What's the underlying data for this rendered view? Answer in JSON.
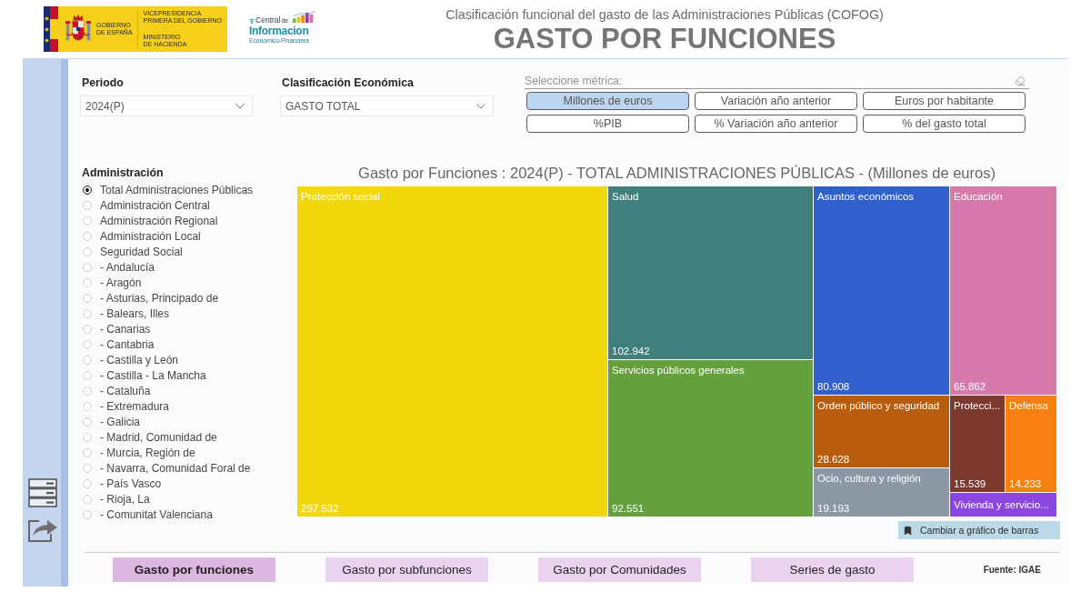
{
  "header": {
    "government_logo": {
      "emblem_lines": [
        "GOBIERNO",
        "DE ESPAÑA"
      ],
      "ministry_blocks": [
        [
          "VICEPRESIDENCIA",
          "PRIMERA DEL GOBIERNO"
        ],
        [
          "MINISTERIO",
          "DE HACIENDA"
        ]
      ]
    },
    "information_logo": {
      "top": "Central",
      "top_small": "de",
      "main": "Informacion",
      "bottom": "Económico-Financiera"
    },
    "subtitle": "Clasificación funcional del gasto de las Administraciones Públicas (COFOG)",
    "title": "GASTO POR FUNCIONES"
  },
  "filters": [
    {
      "label": "Periodo",
      "value": "2024(P)"
    },
    {
      "label": "Clasificación Económica",
      "value": "GASTO TOTAL"
    }
  ],
  "metric_selector": {
    "label": "Seleccione métrica:",
    "options": [
      {
        "label": "Millones de euros",
        "selected": true
      },
      {
        "label": "Variación año anterior",
        "selected": false
      },
      {
        "label": "Euros por habitante",
        "selected": false
      },
      {
        "label": "%PIB",
        "selected": false
      },
      {
        "label": "% Variación año anterior",
        "selected": false
      },
      {
        "label": "% del gasto total",
        "selected": false
      }
    ]
  },
  "administration": {
    "label": "Administración",
    "options": [
      {
        "label": "Total Administraciones Públicas",
        "selected": true
      },
      {
        "label": "Administración Central",
        "selected": false
      },
      {
        "label": "Administración Regional",
        "selected": false
      },
      {
        "label": "Administración Local",
        "selected": false
      },
      {
        "label": "Seguridad Social",
        "selected": false
      },
      {
        "label": "- Andalucía",
        "selected": false
      },
      {
        "label": "- Aragón",
        "selected": false
      },
      {
        "label": "- Asturias, Principado de",
        "selected": false
      },
      {
        "label": "- Balears, Illes",
        "selected": false
      },
      {
        "label": "- Canarias",
        "selected": false
      },
      {
        "label": "- Cantabria",
        "selected": false
      },
      {
        "label": "- Castilla y León",
        "selected": false
      },
      {
        "label": "- Castilla - La Mancha",
        "selected": false
      },
      {
        "label": "- Cataluña",
        "selected": false
      },
      {
        "label": "- Extremadura",
        "selected": false
      },
      {
        "label": "- Galicia",
        "selected": false
      },
      {
        "label": "- Madrid, Comunidad de",
        "selected": false
      },
      {
        "label": "- Murcia, Región de",
        "selected": false
      },
      {
        "label": "- Navarra, Comunidad Foral de",
        "selected": false
      },
      {
        "label": "- País Vasco",
        "selected": false
      },
      {
        "label": "- Rioja, La",
        "selected": false
      },
      {
        "label": "- Comunitat Valenciana",
        "selected": false
      }
    ]
  },
  "treemap": {
    "title": "Gasto por Funciones : 2024(P) - TOTAL ADMINISTRACIONES PÚBLICAS - (Millones de euros)",
    "tiles": [
      {
        "name": "Protección social",
        "value": "297.532",
        "color": "#f2d80b"
      },
      {
        "name": "Salud",
        "value": "102.942",
        "color": "#3f807c"
      },
      {
        "name": "Servicios públicos generales",
        "value": "92.551",
        "color": "#64a03b"
      },
      {
        "name": "Asuntos económicos",
        "value": "80.908",
        "color": "#3060cc"
      },
      {
        "name": "Educación",
        "value": "65.862",
        "color": "#d57aab"
      },
      {
        "name": "Orden público y seguridad",
        "value": "28.628",
        "color": "#b85d0d"
      },
      {
        "name": "Ocio, cultura y religión",
        "value": "19.193",
        "color": "#8c98a4"
      },
      {
        "name": "Protecci...",
        "value": "15.539",
        "color": "#7b3a2d"
      },
      {
        "name": "Defensa",
        "value": "14.233",
        "color": "#f88010"
      },
      {
        "name": "Vivienda y servicio...",
        "color": "#8b45e0"
      }
    ]
  },
  "chart_toggle_button": "Cambiar a gráfico de barras",
  "nav_tabs": [
    {
      "label": "Gasto por funciones",
      "selected": true
    },
    {
      "label": "Gasto por subfunciones",
      "selected": false
    },
    {
      "label": "Gasto por Comunidades",
      "selected": false
    },
    {
      "label": "Series de gasto",
      "selected": false
    }
  ],
  "source": "Fuente: IGAE"
}
